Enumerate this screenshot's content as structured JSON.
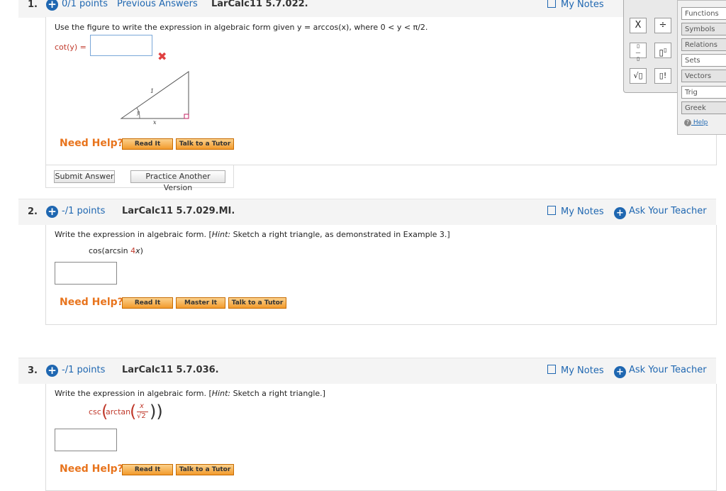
{
  "questions": [
    {
      "number": "1.",
      "points": "0/1 points",
      "previous_answers": "Previous Answers",
      "code": "LarCalc11 5.7.022.",
      "my_notes": "My Notes",
      "prompt": "Use the figure to write the expression in algebraic form given y = arccos(x), where 0 < y < π/2.",
      "answer_label": "cot(y) =",
      "answer_value": "",
      "triangle": {
        "hyp": "1",
        "base": "x",
        "angle": "y"
      },
      "need_help": "Need Help?",
      "help_buttons": [
        "Read It",
        "Talk to a Tutor"
      ],
      "submit": "Submit Answer",
      "practice": "Practice Another Version"
    },
    {
      "number": "2.",
      "points": "-/1 points",
      "code": "LarCalc11 5.7.029.MI.",
      "my_notes": "My Notes",
      "ask_teacher": "Ask Your Teacher",
      "prompt_prefix": "Write the expression in algebraic form. [",
      "hint_label": "Hint:",
      "prompt_suffix": " Sketch a right triangle, as demonstrated in Example 3.]",
      "expr_a": "cos(arcsin ",
      "expr_red": "4",
      "expr_var": "x",
      "expr_b": ")",
      "answer_value": "",
      "need_help": "Need Help?",
      "help_buttons": [
        "Read It",
        "Master It",
        "Talk to a Tutor"
      ]
    },
    {
      "number": "3.",
      "points": "-/1 points",
      "code": "LarCalc11 5.7.036.",
      "my_notes": "My Notes",
      "ask_teacher": "Ask Your Teacher",
      "prompt_prefix": "Write the expression in algebraic form. [",
      "hint_label": "Hint:",
      "prompt_suffix": " Sketch a right triangle.]",
      "expr_csc": "csc",
      "expr_arctan": "arctan",
      "expr_num": "x",
      "expr_den": "√2",
      "answer_value": "",
      "need_help": "Need Help?",
      "help_buttons": [
        "Read It",
        "Talk to a Tutor"
      ]
    }
  ],
  "keypad": {
    "times": "X",
    "divide": "÷",
    "sqrt": "√▯",
    "factorial": "▯!"
  },
  "tabs": [
    "Functions",
    "Symbols",
    "Relations",
    "Sets",
    "Vectors",
    "Trig",
    "Greek"
  ],
  "help_link": "Help",
  "colors": {
    "link": "#1f67b1",
    "help": "#e8741d",
    "error": "#e04040"
  }
}
